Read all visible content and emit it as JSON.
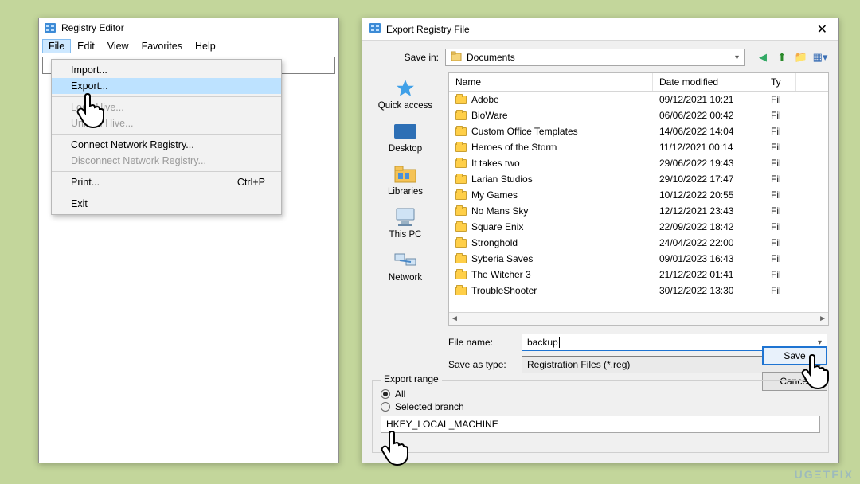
{
  "reged": {
    "title": "Registry Editor",
    "menus": {
      "file": "File",
      "edit": "Edit",
      "view": "View",
      "favorites": "Favorites",
      "help": "Help"
    },
    "file_menu": {
      "import": "Import...",
      "export": "Export...",
      "load_hive": "Load Hive...",
      "unload_hive": "Unload Hive...",
      "connect": "Connect Network Registry...",
      "disconnect": "Disconnect Network Registry...",
      "print": "Print...",
      "print_accel": "Ctrl+P",
      "exit": "Exit"
    }
  },
  "dlg": {
    "title": "Export Registry File",
    "save_in_label": "Save in:",
    "save_in_value": "Documents",
    "columns": {
      "name": "Name",
      "date": "Date modified",
      "type": "Ty"
    },
    "places": {
      "quick": "Quick access",
      "desktop": "Desktop",
      "libraries": "Libraries",
      "thispc": "This PC",
      "network": "Network"
    },
    "rows": [
      {
        "name": "Adobe",
        "date": "09/12/2021 10:21",
        "type": "Fil"
      },
      {
        "name": "BioWare",
        "date": "06/06/2022 00:42",
        "type": "Fil"
      },
      {
        "name": "Custom Office Templates",
        "date": "14/06/2022 14:04",
        "type": "Fil"
      },
      {
        "name": "Heroes of the Storm",
        "date": "11/12/2021 00:14",
        "type": "Fil"
      },
      {
        "name": "It takes two",
        "date": "29/06/2022 19:43",
        "type": "Fil"
      },
      {
        "name": "Larian Studios",
        "date": "29/10/2022 17:47",
        "type": "Fil"
      },
      {
        "name": "My Games",
        "date": "10/12/2022 20:55",
        "type": "Fil"
      },
      {
        "name": "No Mans Sky",
        "date": "12/12/2021 23:43",
        "type": "Fil"
      },
      {
        "name": "Square Enix",
        "date": "22/09/2022 18:42",
        "type": "Fil"
      },
      {
        "name": "Stronghold",
        "date": "24/04/2022 22:00",
        "type": "Fil"
      },
      {
        "name": "Syberia Saves",
        "date": "09/01/2023 16:43",
        "type": "Fil"
      },
      {
        "name": "The Witcher 3",
        "date": "21/12/2022 01:41",
        "type": "Fil"
      },
      {
        "name": "TroubleShooter",
        "date": "30/12/2022 13:30",
        "type": "Fil"
      }
    ],
    "filename_label": "File name:",
    "filename_value": "backup",
    "saveas_label": "Save as type:",
    "saveas_value": "Registration Files (*.reg)",
    "save_btn": "Save",
    "cancel_btn": "Cancel",
    "export_range": {
      "legend": "Export range",
      "all": "All",
      "selected": "Selected branch",
      "branch_value": "HKEY_LOCAL_MACHINE"
    }
  },
  "watermark": "UGΞTFIX"
}
